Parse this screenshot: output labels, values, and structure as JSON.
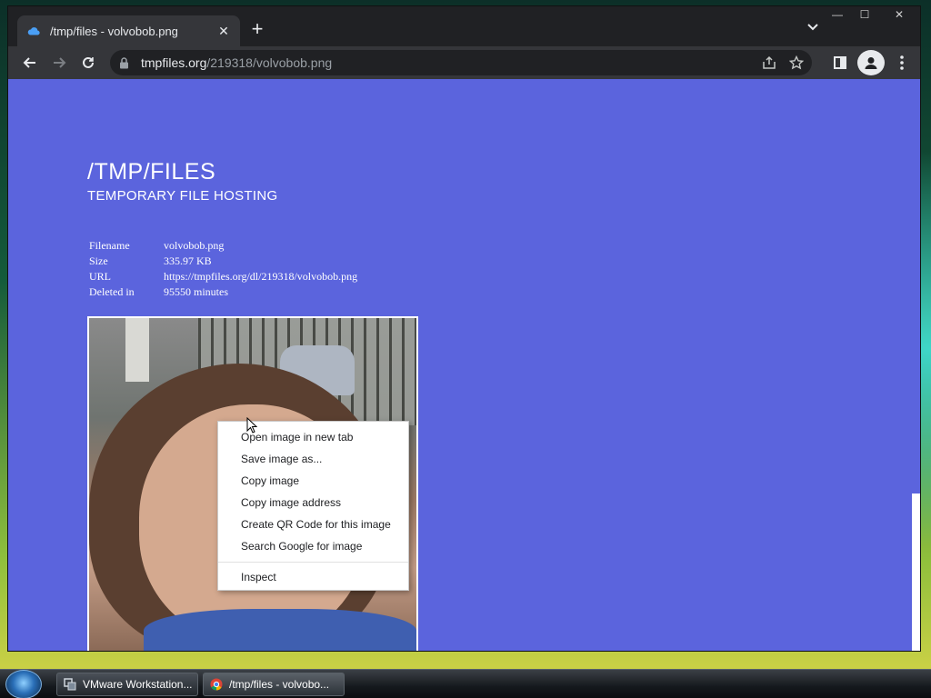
{
  "browser": {
    "tab_title": "/tmp/files - volvobob.png",
    "url_host": "tmpfiles.org",
    "url_path": "/219318/volvobob.png",
    "window_controls": [
      "—",
      "☐",
      "✕"
    ]
  },
  "page": {
    "title": "/TMP/FILES",
    "subtitle": "TEMPORARY FILE HOSTING",
    "background": "#5b64dd",
    "file_info": [
      {
        "label": "Filename",
        "value": "volvobob.png"
      },
      {
        "label": "Size",
        "value": "335.97 KB"
      },
      {
        "label": "URL",
        "value": "https://tmpfiles.org/dl/219318/volvobob.png"
      },
      {
        "label": "Deleted in",
        "value": "95550 minutes"
      }
    ]
  },
  "context_menu": {
    "items": [
      "Open image in new tab",
      "Save image as...",
      "Copy image",
      "Copy image address",
      "Create QR Code for this image",
      "Search Google for image"
    ],
    "inspect": "Inspect"
  },
  "taskbar": {
    "tasks": [
      {
        "label": "VMware Workstation...",
        "icon": "vmware-icon"
      },
      {
        "label": "/tmp/files - volvobo...",
        "icon": "chrome-icon"
      }
    ]
  }
}
